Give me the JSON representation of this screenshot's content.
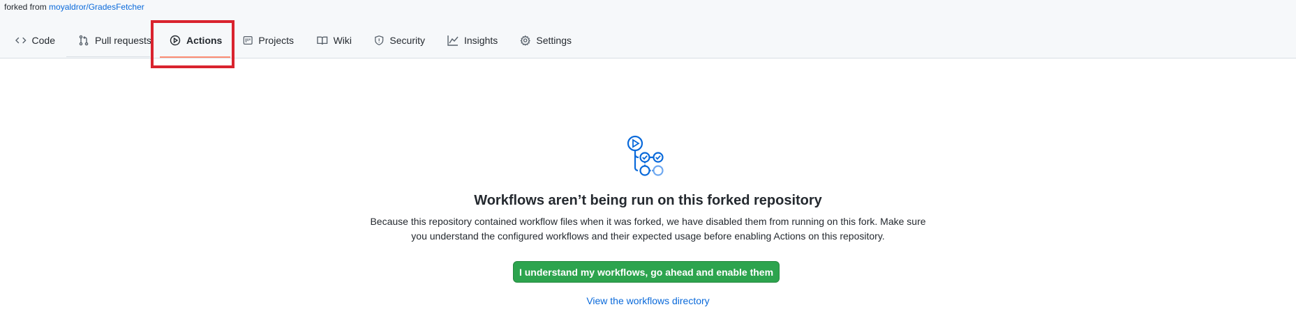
{
  "repo": {
    "forked_prefix": "forked from",
    "forked_source": "moyaldror/GradesFetcher"
  },
  "nav": {
    "tabs": [
      {
        "label": "Code",
        "icon": "code-icon"
      },
      {
        "label": "Pull requests",
        "icon": "pull-request-icon"
      },
      {
        "label": "Actions",
        "icon": "play-icon",
        "active": true
      },
      {
        "label": "Projects",
        "icon": "project-icon"
      },
      {
        "label": "Wiki",
        "icon": "book-icon"
      },
      {
        "label": "Security",
        "icon": "shield-icon"
      },
      {
        "label": "Insights",
        "icon": "graph-icon"
      },
      {
        "label": "Settings",
        "icon": "gear-icon"
      }
    ]
  },
  "main": {
    "illustration": "workflow-icon",
    "title": "Workflows aren’t being run on this forked repository",
    "description_line1": "Because this repository contained workflow files when it was forked, we have disabled them from running on this fork. Make sure",
    "description_line2": "you understand the configured workflows and their expected usage before enabling Actions on this repository.",
    "enable_button": "I understand my workflows, go ahead and enable them",
    "view_link": "View the workflows directory"
  },
  "colors": {
    "accent_green": "#2da44e",
    "link_blue": "#0969da",
    "active_underline": "#fd8c73",
    "highlight_red": "#d9232e"
  }
}
